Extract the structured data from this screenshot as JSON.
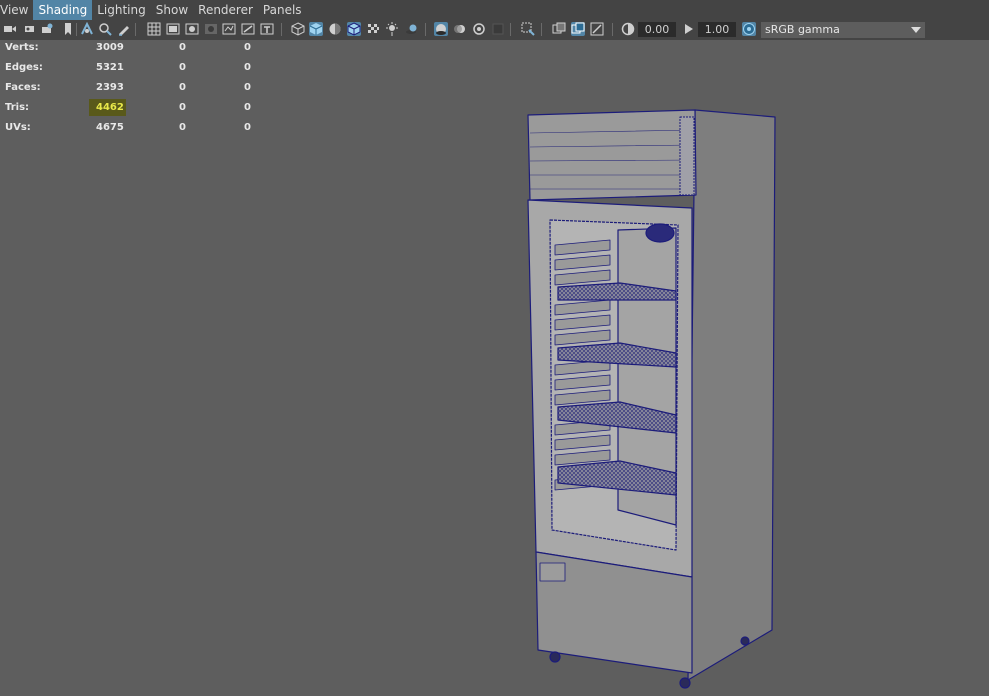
{
  "menu": {
    "items": [
      "View",
      "Shading",
      "Lighting",
      "Show",
      "Renderer",
      "Panels"
    ],
    "active": "Shading"
  },
  "toolbar": {
    "exposure_value": "0.00",
    "gamma_value": "1.00",
    "color_space": "sRGB gamma"
  },
  "hud": {
    "rows": [
      {
        "label": "Verts:",
        "v1": "3009",
        "v2": "0",
        "v3": "0"
      },
      {
        "label": "Edges:",
        "v1": "5321",
        "v2": "0",
        "v3": "0"
      },
      {
        "label": "Faces:",
        "v1": "2393",
        "v2": "0",
        "v3": "0"
      },
      {
        "label": "Tris:",
        "v1": "4462",
        "v2": "0",
        "v3": "0"
      },
      {
        "label": "UVs:",
        "v1": "4675",
        "v2": "0",
        "v3": "0"
      }
    ],
    "highlighted_row": "Tris:"
  },
  "colors": {
    "viewport_bg": "#5e5e5e",
    "toolbar_bg": "#444444",
    "accent": "#5285a6",
    "wireframe": "#1c1c7a",
    "highlight_text": "#e8e84a"
  }
}
